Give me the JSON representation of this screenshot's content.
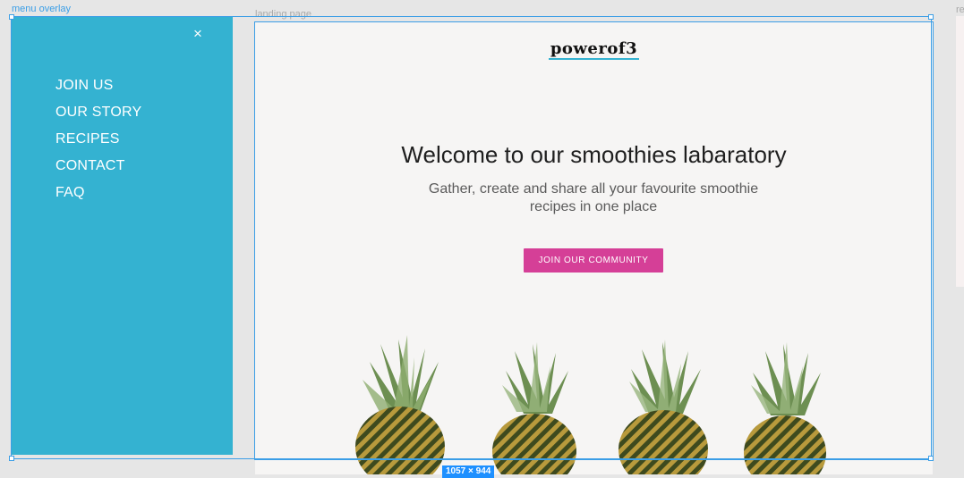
{
  "canvas": {
    "frame_labels": {
      "menu": "menu overlay",
      "landing": "landing page",
      "right": "re"
    },
    "selection_size": "1057 × 944"
  },
  "menu_overlay": {
    "close_icon": "×",
    "items": [
      {
        "label": "JOIN US"
      },
      {
        "label": "OUR STORY"
      },
      {
        "label": "RECIPES"
      },
      {
        "label": "CONTACT"
      },
      {
        "label": "FAQ"
      }
    ],
    "background_color": "#34b2d1"
  },
  "landing": {
    "logo": "powerof3",
    "title": "Welcome to our smoothies labaratory",
    "subtitle": "Gather, create and share all your favourite smoothie recipes in one place",
    "cta_label": "JOIN OUR COMMUNITY",
    "cta_color": "#d53f97",
    "hero_image": "pineapples-photo"
  }
}
